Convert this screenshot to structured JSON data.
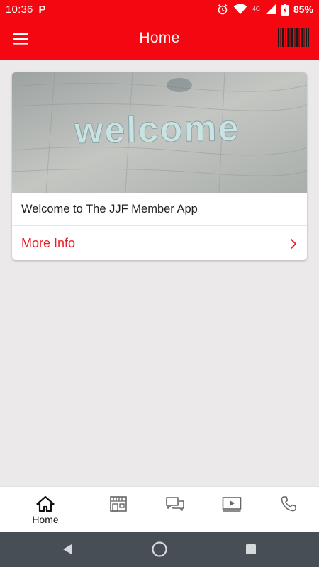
{
  "status_bar": {
    "time": "10:36",
    "app_indicator": "P",
    "network_label": "4G",
    "battery_percent": "85%",
    "icons": [
      "alarm-icon",
      "wifi-icon",
      "signal-icon",
      "battery-icon"
    ]
  },
  "app_bar": {
    "title": "Home",
    "menu_icon": "hamburger-menu-icon",
    "action_icon": "barcode-icon"
  },
  "card": {
    "image_text": "welcome",
    "title": "Welcome to The JJF Member App",
    "link_label": "More Info"
  },
  "bottom_nav": {
    "items": [
      {
        "label": "Home",
        "icon": "home-icon",
        "active": true
      },
      {
        "label": "",
        "icon": "store-icon",
        "active": false
      },
      {
        "label": "",
        "icon": "chat-icon",
        "active": false
      },
      {
        "label": "",
        "icon": "video-icon",
        "active": false
      },
      {
        "label": "",
        "icon": "phone-icon",
        "active": false
      }
    ]
  },
  "colors": {
    "brand_red": "#f50711",
    "link_red": "#e81c24",
    "background": "#ebe9e9",
    "system_nav": "#474e55"
  }
}
